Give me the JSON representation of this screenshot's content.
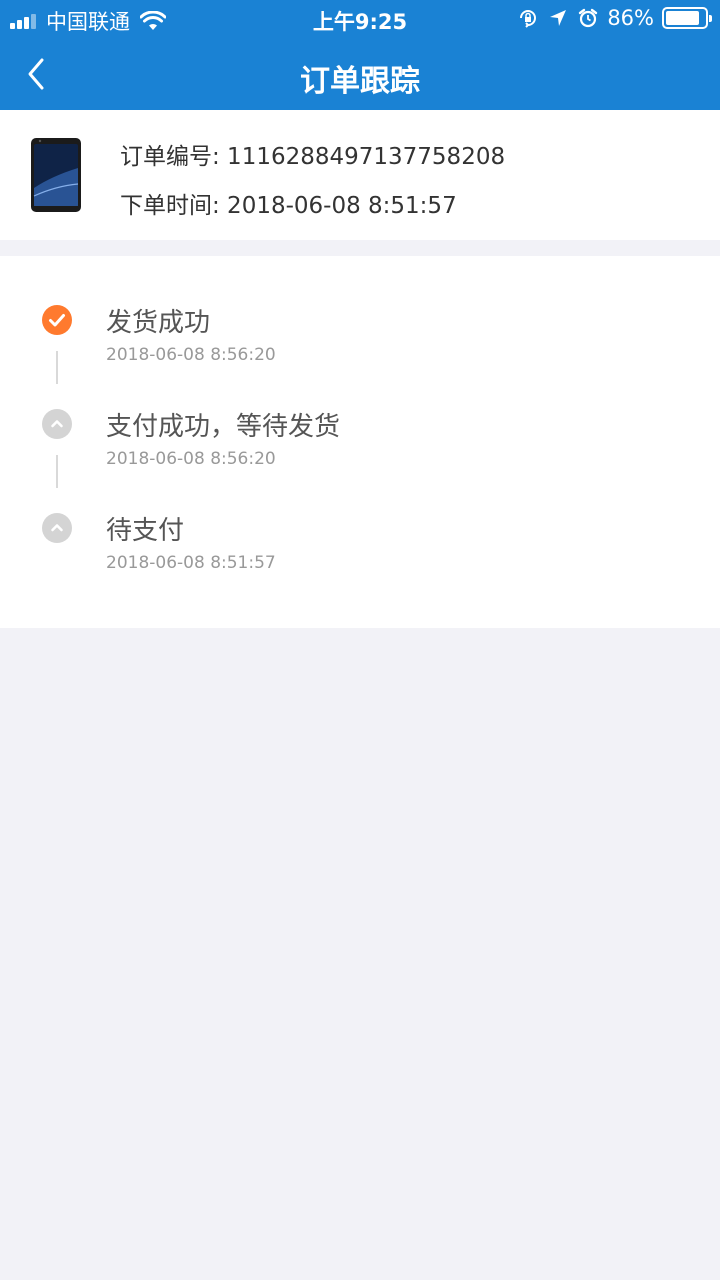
{
  "status_bar": {
    "carrier": "中国联通",
    "time": "上午9:25",
    "battery_percent": "86%",
    "battery_level": 0.86
  },
  "nav": {
    "title": "订单跟踪",
    "back_icon": "chevron-left-icon"
  },
  "order": {
    "number_line": "订单编号: 1116288497137758208",
    "time_line": "下单时间: 2018-06-08 8:51:57"
  },
  "tracking": {
    "steps": [
      {
        "title": "发货成功",
        "time": "2018-06-08 8:56:20",
        "state": "done",
        "color": "#ff7a2e"
      },
      {
        "title": "支付成功，等待发货",
        "time": "2018-06-08 8:56:20",
        "state": "past",
        "color": "#d4d4d4"
      },
      {
        "title": "待支付",
        "time": "2018-06-08 8:51:57",
        "state": "past",
        "color": "#d4d4d4"
      }
    ]
  },
  "colors": {
    "header": "#1a82d4",
    "page_background": "#f2f2f7",
    "accent_orange": "#ff7a2e"
  }
}
